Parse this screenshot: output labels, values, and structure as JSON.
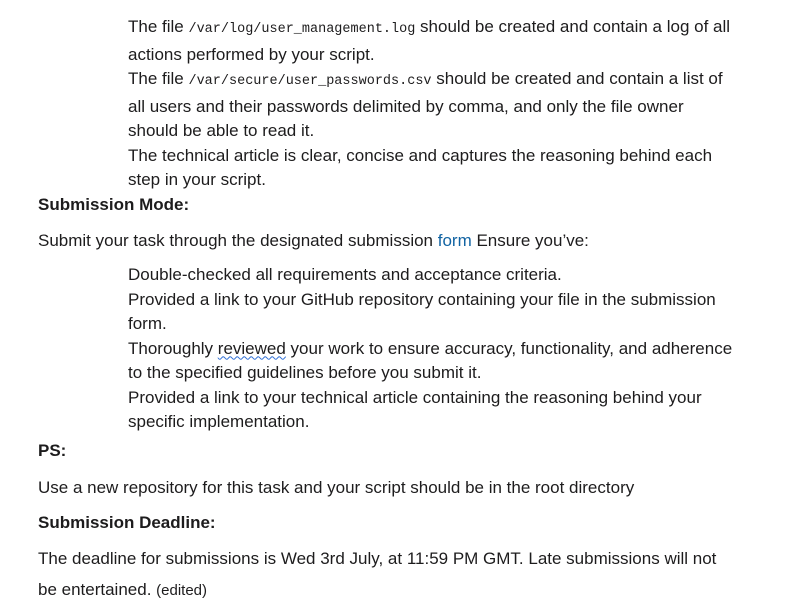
{
  "criteria": {
    "log_pre": "The file ",
    "log_path": "/var/log/user_management.log",
    "log_post_a": " should be created and contain a log of all",
    "log_post_b": "actions performed by your script.",
    "pw_pre": "The file ",
    "pw_path": "/var/secure/user_passwords.csv",
    "pw_post_a": " should be created and contain a list of",
    "pw_post_b": "all users and their passwords delimited by comma, and only the file owner",
    "pw_post_c": "should be able to read it.",
    "article_a": "The technical article is clear, concise and captures the reasoning behind each",
    "article_b": "step in your script."
  },
  "submission_mode": {
    "heading": "Submission Mode:",
    "intro_pre": "Submit your task through the designated submission ",
    "link_text": "form",
    "intro_post": " Ensure you’ve:",
    "checklist": {
      "item1": "Double-checked all requirements and acceptance criteria.",
      "item2_a": "Provided a link to your GitHub repository containing your file in the submission",
      "item2_b": "form.",
      "item3_pre": "Thoroughly ",
      "item3_word": "reviewed",
      "item3_post": " your work to ensure accuracy, functionality, and adherence",
      "item3_b": "to the specified guidelines before you submit it.",
      "item4_a": "Provided a link to your technical article containing the reasoning behind your",
      "item4_b": "specific implementation."
    }
  },
  "ps": {
    "heading": "PS:",
    "text": "Use a new repository for this task and your script should be in the root directory"
  },
  "deadline": {
    "heading": "Submission Deadline:",
    "text_a": "The deadline for submissions is Wed 3rd July, at 11:59 PM GMT. Late submissions will not",
    "text_b": "be entertained.",
    "edited": "(edited)"
  },
  "colors": {
    "text": "#1d1c1d",
    "link": "#1264a3",
    "spellcheck": "#2f6fd6",
    "background": "#ffffff"
  }
}
